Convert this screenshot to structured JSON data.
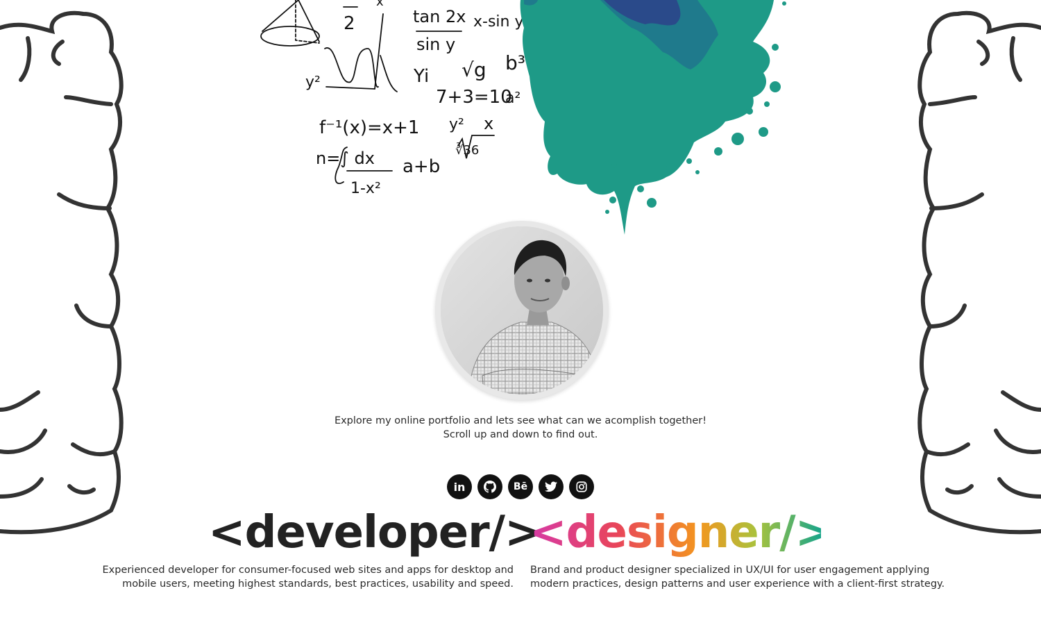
{
  "intro": {
    "line1": "Explore my online portfolio and lets see what can we acomplish together!",
    "line2": "Scroll up and down to find out."
  },
  "socials": [
    {
      "name": "linkedin-icon",
      "glyph": "in"
    },
    {
      "name": "github-icon",
      "glyph": "●"
    },
    {
      "name": "behance-icon",
      "glyph": "Bē"
    },
    {
      "name": "twitter-icon",
      "glyph": "❧"
    },
    {
      "name": "instagram-icon",
      "glyph": "◎"
    }
  ],
  "headlines": {
    "developer": "<developer/>",
    "designer": "<designer/>"
  },
  "descriptions": {
    "developer_line1": "Experienced developer for consumer-focused web sites and apps for desktop and",
    "developer_line2": "mobile users, meeting highest standards, best practices, usability and speed.",
    "designer_line1": "Brand and product designer specialized in UX/UI for user engagement applying",
    "designer_line2": "modern practices, design patterns and user experience with a client-first strategy."
  },
  "math_art": {
    "formulas": [
      "2",
      "x",
      "tan 2x",
      "x-sin y",
      "sin y",
      "y²",
      "Yi",
      "√g",
      "b³",
      "7+3=10",
      "a²",
      "f⁻¹(x)=x+1",
      "y²",
      "x",
      "∛36",
      "n=∫ dx",
      "1-x²",
      "a+b"
    ]
  },
  "colors": {
    "splash_dark": "#2a4a8a",
    "splash_mid": "#1f7a8c",
    "splash_light": "#1e9a87",
    "text": "#2a2a2a",
    "icon_bg": "#111111"
  }
}
